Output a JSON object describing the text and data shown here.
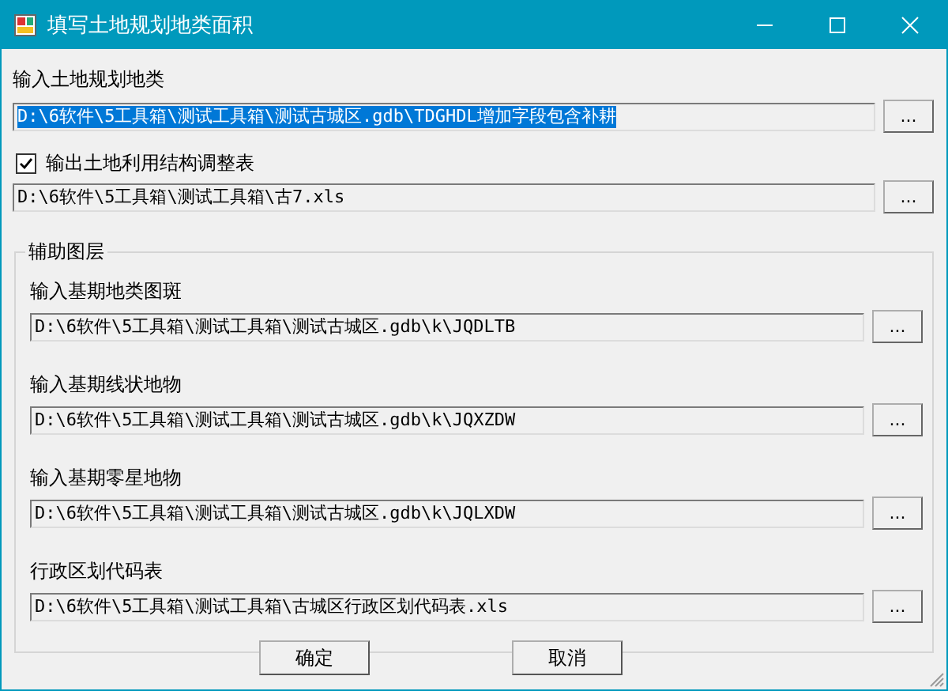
{
  "window": {
    "title": "填写土地规划地类面积"
  },
  "main_input": {
    "label": "输入土地规划地类",
    "value": "D:\\6软件\\5工具箱\\测试工具箱\\测试古城区.gdb\\TDGHDL增加字段包含补耕",
    "text_selected": true,
    "browse": "..."
  },
  "output": {
    "label": "输出土地利用结构调整表",
    "checked": true,
    "value": "D:\\6软件\\5工具箱\\测试工具箱\\古7.xls",
    "text_selected": false,
    "browse": "..."
  },
  "group": {
    "title": "辅助图层",
    "fields": [
      {
        "label": "输入基期地类图斑",
        "value": "D:\\6软件\\5工具箱\\测试工具箱\\测试古城区.gdb\\k\\JQDLTB",
        "text_selected": false,
        "browse": "..."
      },
      {
        "label": "输入基期线状地物",
        "value": "D:\\6软件\\5工具箱\\测试工具箱\\测试古城区.gdb\\k\\JQXZDW",
        "text_selected": false,
        "browse": "..."
      },
      {
        "label": "输入基期零星地物",
        "value": "D:\\6软件\\5工具箱\\测试工具箱\\测试古城区.gdb\\k\\JQLXDW",
        "text_selected": false,
        "browse": "..."
      },
      {
        "label": "行政区划代码表",
        "value": "D:\\6软件\\5工具箱\\测试工具箱\\古城区行政区划代码表.xls",
        "text_selected": false,
        "browse": "..."
      }
    ]
  },
  "buttons": [
    "确定",
    "取消"
  ]
}
